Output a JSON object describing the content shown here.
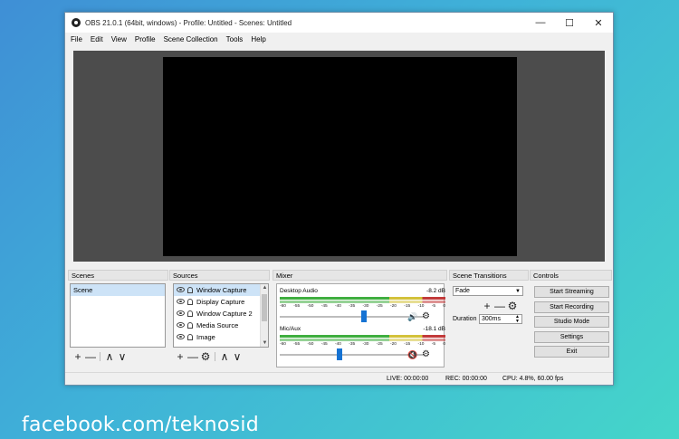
{
  "window": {
    "title": "OBS 21.0.1 (64bit, windows) - Profile: Untitled - Scenes: Untitled",
    "controls": {
      "minimize": "—",
      "maximize": "☐",
      "close": "✕"
    }
  },
  "menu": [
    "File",
    "Edit",
    "View",
    "Profile",
    "Scene Collection",
    "Tools",
    "Help"
  ],
  "docks": {
    "scenes": {
      "title": "Scenes",
      "items": [
        "Scene"
      ]
    },
    "sources": {
      "title": "Sources",
      "items": [
        "Window Capture",
        "Display Capture",
        "Window Capture 2",
        "Media Source",
        "Image"
      ]
    },
    "mixer": {
      "title": "Mixer",
      "tracks": [
        {
          "name": "Desktop Audio",
          "level": "-8.2 dB",
          "volume_fraction": 0.58,
          "muted": false
        },
        {
          "name": "Mic/Aux",
          "level": "-18.1 dB",
          "volume_fraction": 0.41,
          "muted": true
        }
      ],
      "ticks": [
        "-60",
        "-55",
        "-50",
        "-45",
        "-40",
        "-35",
        "-30",
        "-25",
        "-20",
        "-15",
        "-10",
        "-5",
        "0"
      ]
    },
    "transitions": {
      "title": "Scene Transitions",
      "selected": "Fade",
      "duration_label": "Duration",
      "duration_value": "300ms"
    },
    "controls": {
      "title": "Controls",
      "buttons": [
        "Start Streaming",
        "Start Recording",
        "Studio Mode",
        "Settings",
        "Exit"
      ]
    }
  },
  "toolbar_glyphs": {
    "add": "+",
    "remove": "—",
    "up": "∧",
    "down": "∨",
    "gear": "⚙"
  },
  "status": {
    "live": "LIVE: 00:00:00",
    "rec": "REC: 00:00:00",
    "cpu": "CPU: 4.8%, 60.00 fps"
  },
  "watermark": "facebook.com/teknosid"
}
